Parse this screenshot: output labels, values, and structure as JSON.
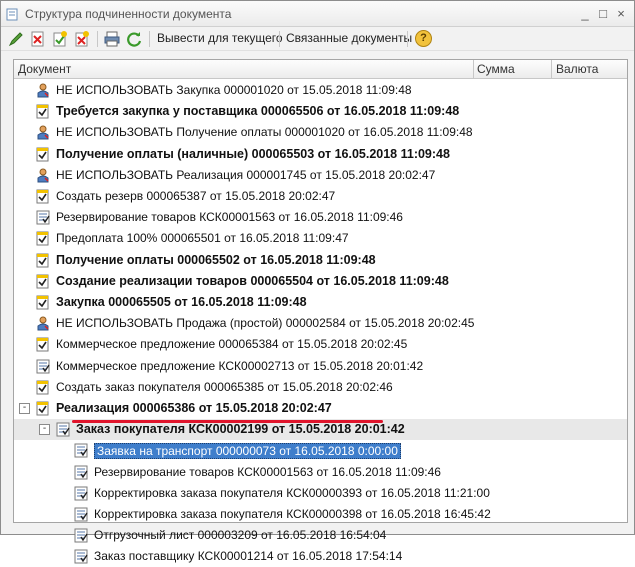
{
  "window": {
    "title": "Структура подчиненности документа",
    "controls": [
      "_",
      "□",
      "×"
    ]
  },
  "toolbar": {
    "print_current": "Вывести для текущего",
    "related_docs": "Связанные документы",
    "help": "?"
  },
  "grid": {
    "columns": [
      "Документ",
      "Сумма",
      "Валюта"
    ],
    "rows": [
      {
        "icon": "doc-user-icon",
        "text": "НЕ ИСПОЛЬЗОВАТЬ Закупка 000001020 от 15.05.2018 11:09:48",
        "bold": false
      },
      {
        "icon": "doc-check-icon",
        "text": "Требуется закупка у поставщика 000065506 от 16.05.2018 11:09:48",
        "bold": true
      },
      {
        "icon": "doc-user-icon",
        "text": "НЕ ИСПОЛЬЗОВАТЬ Получение оплаты 000001020 от 16.05.2018 11:09:48",
        "bold": false
      },
      {
        "icon": "doc-check-icon",
        "text": "Получение оплаты (наличные) 000065503 от 16.05.2018 11:09:48",
        "bold": true
      },
      {
        "icon": "doc-user-icon",
        "text": "НЕ ИСПОЛЬЗОВАТЬ Реализация 000001745 от 15.05.2018 20:02:47",
        "bold": false
      },
      {
        "icon": "doc-check-icon",
        "text": "Создать резерв 000065387 от 15.05.2018 20:02:47",
        "bold": false
      },
      {
        "icon": "doc-list-icon",
        "text": "Резервирование товаров КСК00001563 от 16.05.2018 11:09:46",
        "bold": false
      },
      {
        "icon": "doc-check-icon",
        "text": "Предоплата 100% 000065501 от 16.05.2018 11:09:47",
        "bold": false
      },
      {
        "icon": "doc-check-icon",
        "text": "Получение оплаты 000065502 от 16.05.2018 11:09:48",
        "bold": true
      },
      {
        "icon": "doc-check-icon",
        "text": "Создание реализации товаров 000065504 от 16.05.2018 11:09:48",
        "bold": true
      },
      {
        "icon": "doc-check-icon",
        "text": "Закупка 000065505 от 16.05.2018 11:09:48",
        "bold": true
      },
      {
        "icon": "doc-user-icon",
        "text": "НЕ ИСПОЛЬЗОВАТЬ Продажа (простой) 000002584 от 15.05.2018 20:02:45",
        "bold": false
      },
      {
        "icon": "doc-check-icon",
        "text": "Коммерческое предложение 000065384 от 15.05.2018 20:02:45",
        "bold": false
      },
      {
        "icon": "doc-list-icon",
        "text": "Коммерческое предложение КСК00002713 от 15.05.2018 20:01:42",
        "bold": false
      },
      {
        "icon": "doc-check-icon",
        "text": "Создать заказ покупателя 000065385 от 15.05.2018 20:02:46",
        "bold": false
      },
      {
        "icon": "doc-check-icon",
        "text": "Реализация 000065386 от 15.05.2018 20:02:47",
        "bold": true,
        "toggle": "-"
      },
      {
        "icon": "doc-list-icon",
        "text": "Заказ покупателя КСК00002199 от 15.05.2018 20:01:42",
        "bold": true,
        "toggle": "-"
      },
      {
        "icon": "doc-list-icon",
        "text": "Заявка на транспорт 000000073 от 16.05.2018 0:00:00",
        "bold": false,
        "selected": true
      },
      {
        "icon": "doc-list-icon",
        "text": "Резервирование товаров КСК00001563 от 16.05.2018 11:09:46",
        "bold": false
      },
      {
        "icon": "doc-list-icon",
        "text": "Корректировка заказа покупателя КСК00000393 от 16.05.2018 11:21:00",
        "bold": false
      },
      {
        "icon": "doc-list-icon",
        "text": "Корректировка заказа покупателя КСК00000398 от 16.05.2018 16:45:42",
        "bold": false
      },
      {
        "icon": "doc-list-icon",
        "text": "Отгрузочный лист 000003209 от 16.05.2018 16:54:04",
        "bold": false
      },
      {
        "icon": "doc-list-icon",
        "text": "Заказ поставщику КСК00001214 от 16.05.2018 17:54:14",
        "bold": false
      }
    ]
  },
  "colors": {
    "selection": "#3f7ecb",
    "mark": "#e0142b",
    "check_yellow": "#f2c200"
  }
}
